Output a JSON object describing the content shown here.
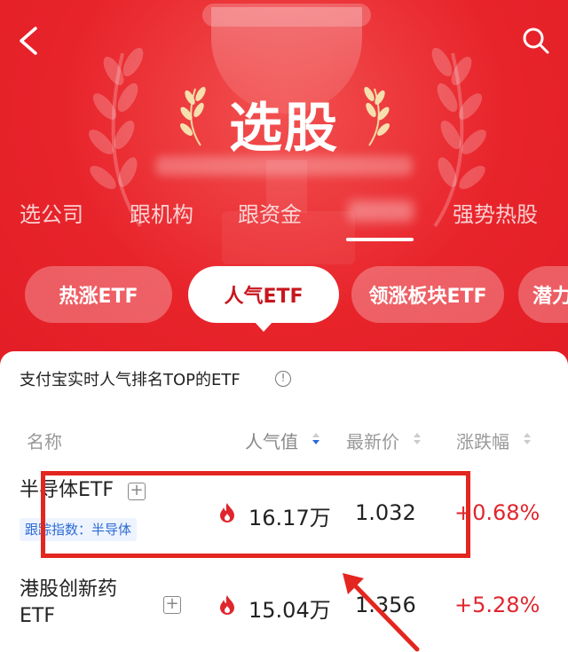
{
  "header": {
    "title": "选股",
    "back_icon": "chevron-left-icon",
    "search_icon": "search-icon"
  },
  "tabs": [
    {
      "label": "选公司"
    },
    {
      "label": "跟机构"
    },
    {
      "label": "跟资金"
    },
    {
      "label": "强势热股"
    }
  ],
  "pills": [
    {
      "label": "热涨ETF",
      "active": false
    },
    {
      "label": "人气ETF",
      "active": true
    },
    {
      "label": "领涨板块ETF",
      "active": false
    },
    {
      "label": "潜力",
      "active": false
    }
  ],
  "card": {
    "title": "支付宝实时人气排名TOP的ETF",
    "columns": {
      "name": "名称",
      "popularity": "人气值",
      "price": "最新价",
      "change": "涨跌幅"
    },
    "rows": [
      {
        "name": "半导体ETF",
        "tag": "跟踪指数：半导体",
        "popularity": "16.17万",
        "price": "1.032",
        "change": "+0.68%"
      },
      {
        "name_line1": "港股创新药",
        "name_line2": "ETF",
        "popularity": "15.04万",
        "price": "1.356",
        "change": "+5.28%"
      }
    ]
  },
  "colors": {
    "brand_red": "#e31d25",
    "rise_red": "#e0262d",
    "tag_blue": "#2b6bd6",
    "annotation_red": "#e3261f"
  }
}
